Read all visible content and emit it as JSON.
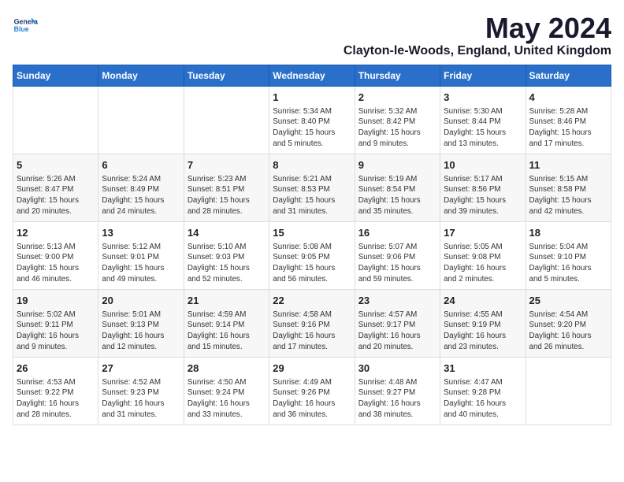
{
  "logo": {
    "line1": "General",
    "line2": "Blue"
  },
  "title": "May 2024",
  "subtitle": "Clayton-le-Woods, England, United Kingdom",
  "days_of_week": [
    "Sunday",
    "Monday",
    "Tuesday",
    "Wednesday",
    "Thursday",
    "Friday",
    "Saturday"
  ],
  "weeks": [
    [
      {
        "day": "",
        "info": ""
      },
      {
        "day": "",
        "info": ""
      },
      {
        "day": "",
        "info": ""
      },
      {
        "day": "1",
        "info": "Sunrise: 5:34 AM\nSunset: 8:40 PM\nDaylight: 15 hours\nand 5 minutes."
      },
      {
        "day": "2",
        "info": "Sunrise: 5:32 AM\nSunset: 8:42 PM\nDaylight: 15 hours\nand 9 minutes."
      },
      {
        "day": "3",
        "info": "Sunrise: 5:30 AM\nSunset: 8:44 PM\nDaylight: 15 hours\nand 13 minutes."
      },
      {
        "day": "4",
        "info": "Sunrise: 5:28 AM\nSunset: 8:46 PM\nDaylight: 15 hours\nand 17 minutes."
      }
    ],
    [
      {
        "day": "5",
        "info": "Sunrise: 5:26 AM\nSunset: 8:47 PM\nDaylight: 15 hours\nand 20 minutes."
      },
      {
        "day": "6",
        "info": "Sunrise: 5:24 AM\nSunset: 8:49 PM\nDaylight: 15 hours\nand 24 minutes."
      },
      {
        "day": "7",
        "info": "Sunrise: 5:23 AM\nSunset: 8:51 PM\nDaylight: 15 hours\nand 28 minutes."
      },
      {
        "day": "8",
        "info": "Sunrise: 5:21 AM\nSunset: 8:53 PM\nDaylight: 15 hours\nand 31 minutes."
      },
      {
        "day": "9",
        "info": "Sunrise: 5:19 AM\nSunset: 8:54 PM\nDaylight: 15 hours\nand 35 minutes."
      },
      {
        "day": "10",
        "info": "Sunrise: 5:17 AM\nSunset: 8:56 PM\nDaylight: 15 hours\nand 39 minutes."
      },
      {
        "day": "11",
        "info": "Sunrise: 5:15 AM\nSunset: 8:58 PM\nDaylight: 15 hours\nand 42 minutes."
      }
    ],
    [
      {
        "day": "12",
        "info": "Sunrise: 5:13 AM\nSunset: 9:00 PM\nDaylight: 15 hours\nand 46 minutes."
      },
      {
        "day": "13",
        "info": "Sunrise: 5:12 AM\nSunset: 9:01 PM\nDaylight: 15 hours\nand 49 minutes."
      },
      {
        "day": "14",
        "info": "Sunrise: 5:10 AM\nSunset: 9:03 PM\nDaylight: 15 hours\nand 52 minutes."
      },
      {
        "day": "15",
        "info": "Sunrise: 5:08 AM\nSunset: 9:05 PM\nDaylight: 15 hours\nand 56 minutes."
      },
      {
        "day": "16",
        "info": "Sunrise: 5:07 AM\nSunset: 9:06 PM\nDaylight: 15 hours\nand 59 minutes."
      },
      {
        "day": "17",
        "info": "Sunrise: 5:05 AM\nSunset: 9:08 PM\nDaylight: 16 hours\nand 2 minutes."
      },
      {
        "day": "18",
        "info": "Sunrise: 5:04 AM\nSunset: 9:10 PM\nDaylight: 16 hours\nand 5 minutes."
      }
    ],
    [
      {
        "day": "19",
        "info": "Sunrise: 5:02 AM\nSunset: 9:11 PM\nDaylight: 16 hours\nand 9 minutes."
      },
      {
        "day": "20",
        "info": "Sunrise: 5:01 AM\nSunset: 9:13 PM\nDaylight: 16 hours\nand 12 minutes."
      },
      {
        "day": "21",
        "info": "Sunrise: 4:59 AM\nSunset: 9:14 PM\nDaylight: 16 hours\nand 15 minutes."
      },
      {
        "day": "22",
        "info": "Sunrise: 4:58 AM\nSunset: 9:16 PM\nDaylight: 16 hours\nand 17 minutes."
      },
      {
        "day": "23",
        "info": "Sunrise: 4:57 AM\nSunset: 9:17 PM\nDaylight: 16 hours\nand 20 minutes."
      },
      {
        "day": "24",
        "info": "Sunrise: 4:55 AM\nSunset: 9:19 PM\nDaylight: 16 hours\nand 23 minutes."
      },
      {
        "day": "25",
        "info": "Sunrise: 4:54 AM\nSunset: 9:20 PM\nDaylight: 16 hours\nand 26 minutes."
      }
    ],
    [
      {
        "day": "26",
        "info": "Sunrise: 4:53 AM\nSunset: 9:22 PM\nDaylight: 16 hours\nand 28 minutes."
      },
      {
        "day": "27",
        "info": "Sunrise: 4:52 AM\nSunset: 9:23 PM\nDaylight: 16 hours\nand 31 minutes."
      },
      {
        "day": "28",
        "info": "Sunrise: 4:50 AM\nSunset: 9:24 PM\nDaylight: 16 hours\nand 33 minutes."
      },
      {
        "day": "29",
        "info": "Sunrise: 4:49 AM\nSunset: 9:26 PM\nDaylight: 16 hours\nand 36 minutes."
      },
      {
        "day": "30",
        "info": "Sunrise: 4:48 AM\nSunset: 9:27 PM\nDaylight: 16 hours\nand 38 minutes."
      },
      {
        "day": "31",
        "info": "Sunrise: 4:47 AM\nSunset: 9:28 PM\nDaylight: 16 hours\nand 40 minutes."
      },
      {
        "day": "",
        "info": ""
      }
    ]
  ]
}
